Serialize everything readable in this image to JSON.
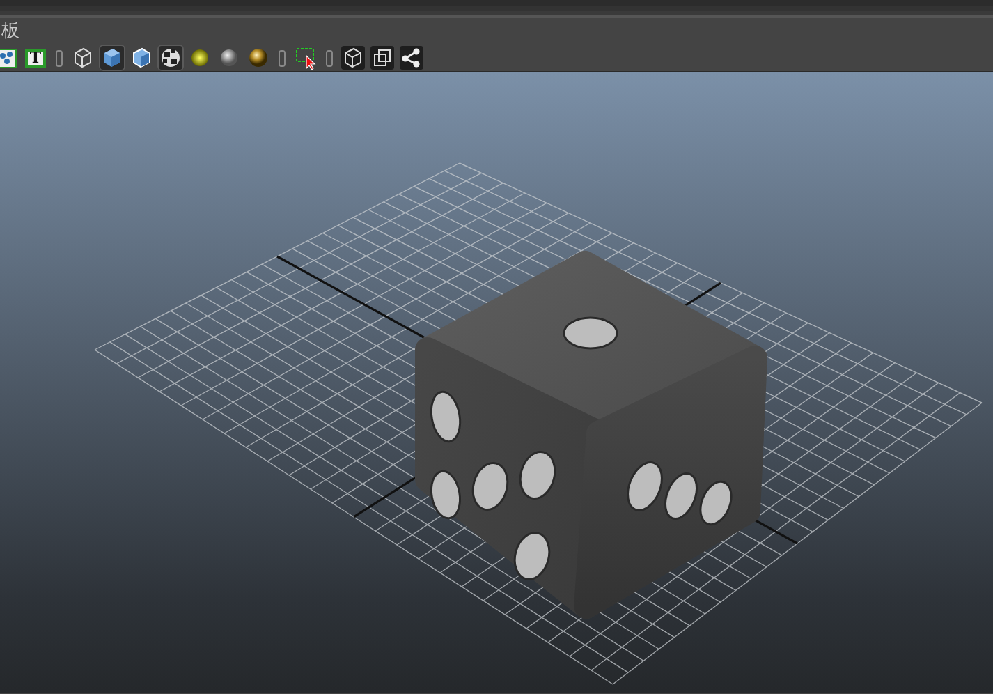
{
  "menu_bar": {
    "label": "板"
  },
  "toolbar": [
    {
      "kind": "nodes",
      "selected": false
    },
    {
      "kind": "text",
      "label": "T",
      "selected": false
    },
    {
      "kind": "separator"
    },
    {
      "kind": "wire-cube",
      "selected": false
    },
    {
      "kind": "shaded-cube",
      "selected": true
    },
    {
      "kind": "light-cube",
      "selected": false
    },
    {
      "kind": "checker",
      "selected": true
    },
    {
      "kind": "yellow-sphere",
      "selected": false
    },
    {
      "kind": "grey-sphere",
      "selected": false
    },
    {
      "kind": "gold-sphere",
      "selected": false
    },
    {
      "kind": "separator"
    },
    {
      "kind": "select-box",
      "selected": false
    },
    {
      "kind": "separator"
    },
    {
      "kind": "dark-cube",
      "selected": false
    },
    {
      "kind": "squares",
      "selected": false
    },
    {
      "kind": "share",
      "selected": false
    }
  ]
}
